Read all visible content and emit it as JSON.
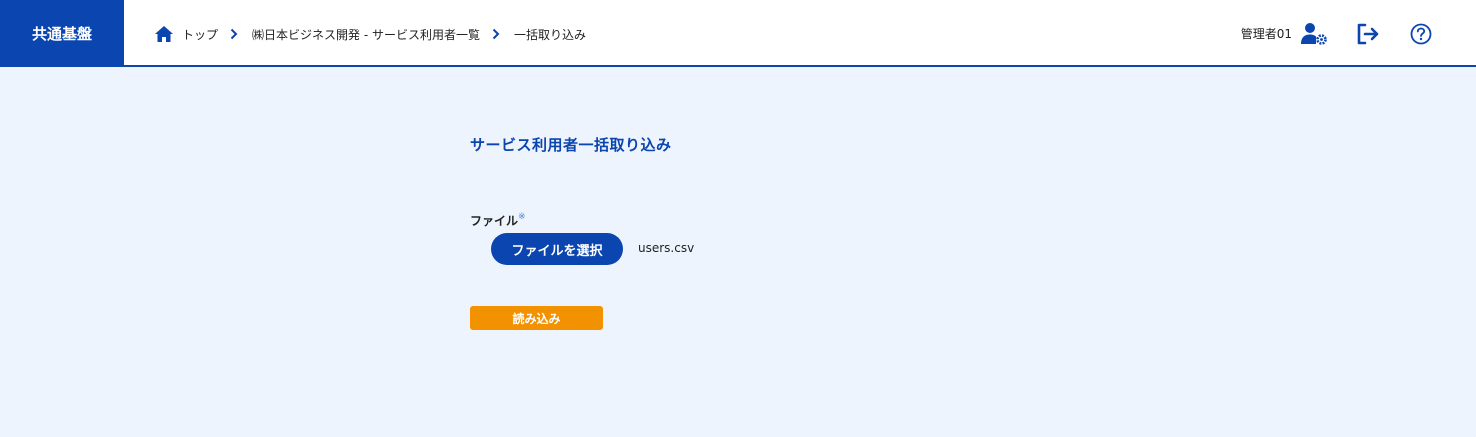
{
  "app": {
    "brand": "共通基盤"
  },
  "breadcrumb": {
    "items": [
      {
        "label": "トップ"
      },
      {
        "label": "㈱日本ビジネス開発 - サービス利用者一覧"
      },
      {
        "label": "一括取り込み"
      }
    ]
  },
  "user": {
    "name": "管理者01"
  },
  "icons": {
    "home": "home-icon",
    "user_settings": "user-gear-icon",
    "logout": "logout-icon",
    "help": "help-icon",
    "chevron": "chevron-right-icon"
  },
  "page": {
    "title": "サービス利用者一括取り込み",
    "file_label": "ファイル",
    "required_mark": "※",
    "file_button": "ファイルを選択",
    "file_name": "users.csv",
    "load_button": "読み込み"
  },
  "colors": {
    "primary": "#0b45b0",
    "accent": "#f39200",
    "background": "#eef4fd"
  }
}
